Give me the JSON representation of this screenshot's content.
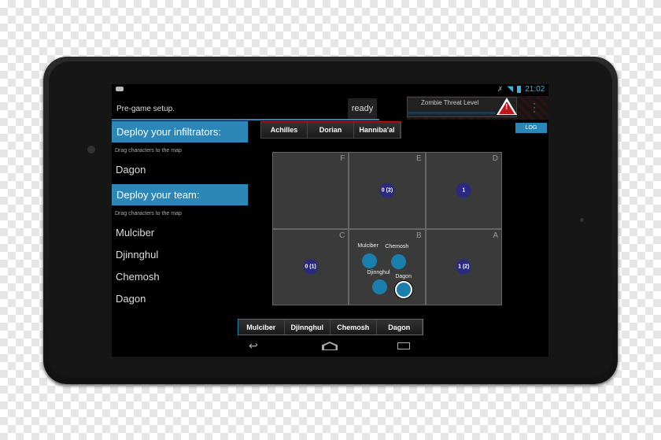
{
  "status_bar": {
    "time": "21:02",
    "icons": [
      "android-notification-icon",
      "wifi-icon",
      "battery-icon"
    ]
  },
  "toolbar": {
    "title": "Pre-game setup.",
    "ready_label": "ready",
    "threat_label": "Zombie Threat Level",
    "menu_icon": "overflow-menu-icon"
  },
  "left_panel": {
    "infiltrators": {
      "header": "Deploy your infiltrators:",
      "hint": "Drag characters to the map",
      "items": [
        "Dagon"
      ]
    },
    "team": {
      "header": "Deploy your team:",
      "hint": "Drag characters to the map",
      "items": [
        "Mulciber",
        "Djinnghul",
        "Chemosh",
        "Dagon"
      ]
    }
  },
  "enemy_tabs": [
    "Achilles",
    "Dorian",
    "Hanniba'al"
  ],
  "log_label": "LOG",
  "map": {
    "cells": [
      {
        "label": "F",
        "zone": ""
      },
      {
        "label": "E",
        "zone": "0 (2)"
      },
      {
        "label": "D",
        "zone": "1"
      },
      {
        "label": "C",
        "zone": "0 (1)"
      },
      {
        "label": "B",
        "zone": ""
      },
      {
        "label": "A",
        "zone": "1 (2)"
      }
    ],
    "characters": [
      "Mulciber",
      "Chemosh",
      "Djinnghul",
      "Dagon"
    ],
    "selected": "Dagon"
  },
  "team_tabs": [
    "Mulciber",
    "Djinnghul",
    "Chemosh",
    "Dagon"
  ],
  "colors": {
    "accent": "#2c86b8",
    "zone": "#2b2a80",
    "character": "#1b7fae",
    "enemy_border": "#c0151b"
  }
}
